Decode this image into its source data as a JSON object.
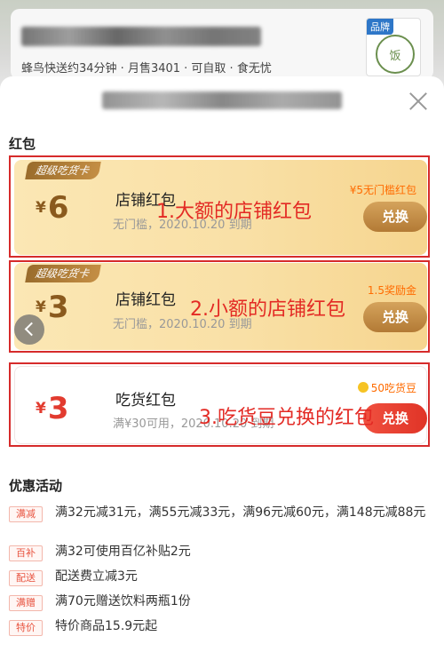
{
  "shop": {
    "brand_tag": "品牌",
    "brand_mark": "饭",
    "info": "蜂鸟快送约34分钟 · 月售3401 · 可自取 · 食无忧"
  },
  "sections": {
    "coupons_title": "红包",
    "promos_title": "优惠活动"
  },
  "coupons": [
    {
      "badge": "超级吃货卡",
      "yen": "¥",
      "amount": "6",
      "title": "店铺红包",
      "subtitle": "无门槛，2020.10.20 到期",
      "note": "¥5无门槛红包",
      "button": "兑换",
      "annotation": "1.大额的店铺红包"
    },
    {
      "badge": "超级吃货卡",
      "yen": "¥",
      "amount": "3",
      "title": "店铺红包",
      "subtitle": "无门槛，2020.10.20 到期",
      "note": "1.5奖励金",
      "button": "兑换",
      "annotation": "2.小额的店铺红包"
    },
    {
      "yen": "¥",
      "amount": "3",
      "title": "吃货红包",
      "subtitle": "满¥30可用，2020.10.20 到期",
      "note": "50吃货豆",
      "button": "兑换",
      "annotation": "3.吃货豆兑换的红包"
    }
  ],
  "promos": [
    {
      "tag": "满减",
      "text": "满32元减31元，满55元减33元，满96元减60元，满148元减88元"
    },
    {
      "tag": "百补",
      "text": "满32可使用百亿补贴2元"
    },
    {
      "tag": "配送",
      "text": "配送费立减3元"
    },
    {
      "tag": "满赠",
      "text": "满70元赠送饮料两瓶1份"
    },
    {
      "tag": "特价",
      "text": "特价商品15.9元起"
    }
  ],
  "colors": {
    "annotation_red": "#e32a24",
    "gold_card": "#f9e0a6",
    "accent_orange": "#ff6b00"
  }
}
